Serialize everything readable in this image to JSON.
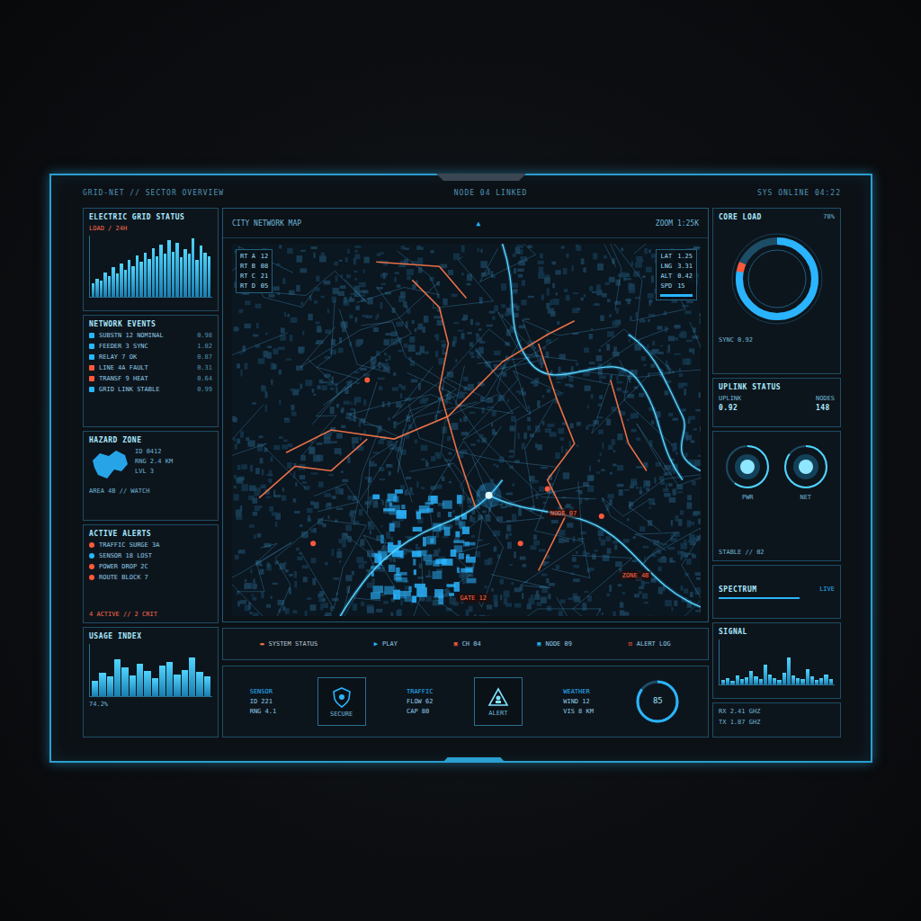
{
  "header": {
    "left": "GRID-NET // SECTOR OVERVIEW",
    "mid": "NODE 04 LINKED",
    "right": "SYS ONLINE 04:22"
  },
  "left": {
    "load": {
      "title": "ELECTRIC GRID STATUS",
      "subtitle": "LOAD / 24H",
      "values": [
        22,
        30,
        26,
        40,
        34,
        48,
        38,
        55,
        44,
        60,
        50,
        68,
        58,
        72,
        62,
        80,
        66,
        85,
        70,
        92,
        74,
        88,
        64,
        78,
        70,
        95,
        60,
        84,
        72,
        66
      ]
    },
    "events": {
      "title": "NETWORK EVENTS",
      "items": [
        {
          "label": "SUBSTN 12 NOMINAL",
          "value": "0.98",
          "color": "#27b7ff"
        },
        {
          "label": "FEEDER 3 SYNC",
          "value": "1.02",
          "color": "#27b7ff"
        },
        {
          "label": "RELAY 7 OK",
          "value": "0.87",
          "color": "#27b7ff"
        },
        {
          "label": "LINE 4A FAULT",
          "value": "0.31",
          "color": "#ff5a3c"
        },
        {
          "label": "TRANSF 9 HEAT",
          "value": "0.64",
          "color": "#ff5a3c"
        },
        {
          "label": "GRID LINK STABLE",
          "value": "0.99",
          "color": "#27b7ff"
        }
      ]
    },
    "hazard": {
      "title": "HAZARD ZONE",
      "caption": "AREA 4B // WATCH",
      "readings": [
        "ID 0412",
        "RNG 2.4 KM",
        "LVL 3"
      ]
    },
    "alerts": {
      "title": "ACTIVE ALERTS",
      "items": [
        {
          "label": "TRAFFIC SURGE 3A",
          "color": "#ff5a3c"
        },
        {
          "label": "SENSOR 18 LOST",
          "color": "#27b7ff"
        },
        {
          "label": "POWER DROP 2C",
          "color": "#ff5a3c"
        },
        {
          "label": "ROUTE BLOCK 7",
          "color": "#ff5a3c"
        }
      ],
      "footer": "4 ACTIVE // 2 CRIT"
    },
    "usage": {
      "title": "USAGE INDEX",
      "values": [
        30,
        45,
        38,
        70,
        55,
        40,
        62,
        48,
        35,
        58,
        66,
        42,
        50,
        74,
        46,
        38
      ],
      "readout": "74.2%"
    }
  },
  "map": {
    "title": "CITY NETWORK MAP",
    "nav": "▲",
    "zoom": "ZOOM 1:25K",
    "legend": [
      {
        "label": "RT A",
        "value": "12"
      },
      {
        "label": "RT B",
        "value": "08"
      },
      {
        "label": "RT C",
        "value": "21"
      },
      {
        "label": "RT D",
        "value": "05"
      }
    ],
    "info": [
      {
        "label": "LAT",
        "value": "1.25"
      },
      {
        "label": "LNG",
        "value": "3.31"
      },
      {
        "label": "ALT",
        "value": "0.42"
      },
      {
        "label": "SPD",
        "value": "15"
      }
    ],
    "markers": [
      "NODE 07",
      "ZONE 4B",
      "GATE 12"
    ]
  },
  "right": {
    "core": {
      "title": "CORE LOAD",
      "value": "78%",
      "level": 0.78,
      "footer": "SYNC 0.92"
    },
    "info": {
      "title": "UPLINK STATUS",
      "rows": [
        {
          "label": "UPLINK",
          "value": "0.92"
        },
        {
          "label": "NODES",
          "value": "148"
        }
      ]
    },
    "dials": {
      "items": [
        {
          "label": "PWR",
          "level": 0.6
        },
        {
          "label": "NET",
          "level": 0.85
        }
      ],
      "footer": "STABLE // 02"
    },
    "spectrum": {
      "title": "SPECTRUM",
      "status": "LIVE"
    },
    "signal": {
      "title": "SIGNAL",
      "values": [
        10,
        14,
        8,
        20,
        12,
        16,
        30,
        18,
        12,
        45,
        22,
        14,
        10,
        26,
        60,
        20,
        15,
        12,
        34,
        18,
        10,
        14,
        22,
        12
      ]
    },
    "footer": [
      "RX 2.41 GHZ",
      "TX 1.87 GHZ"
    ]
  },
  "bottom": {
    "controls": [
      {
        "icon": "▬",
        "label": "SYSTEM STATUS",
        "color": "#ff7a4a"
      },
      {
        "icon": "▶",
        "label": "PLAY",
        "color": "#27b7ff"
      },
      {
        "icon": "▣",
        "label": "CH 04",
        "color": "#ff5a3c"
      },
      {
        "icon": "▣",
        "label": "NODE 09",
        "color": "#27b7ff"
      },
      {
        "icon": "⊡",
        "label": "ALERT LOG",
        "color": "#ff5a3c"
      }
    ],
    "tiles": [
      {
        "kind": "readout",
        "title": "SENSOR",
        "lines": [
          "ID 221",
          "RNG 4.1"
        ]
      },
      {
        "kind": "badge",
        "title": "SECURE"
      },
      {
        "kind": "readout",
        "title": "TRAFFIC",
        "lines": [
          "FLOW 62",
          "CAP 80"
        ]
      },
      {
        "kind": "badge",
        "title": "ALERT"
      },
      {
        "kind": "readout",
        "title": "WEATHER",
        "lines": [
          "WIND 12",
          "VIS 8 KM"
        ]
      }
    ],
    "gauge": {
      "label": "85",
      "level": 0.85
    }
  }
}
